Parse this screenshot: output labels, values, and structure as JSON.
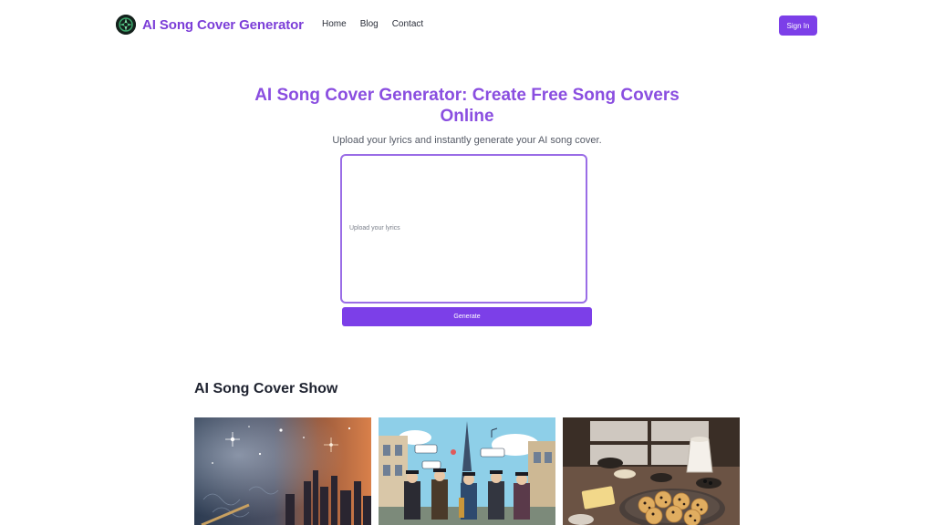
{
  "header": {
    "brand": "AI Song Cover Generator",
    "nav": [
      "Home",
      "Blog",
      "Contact"
    ],
    "sign_in": "Sign In"
  },
  "hero": {
    "title": "AI Song Cover Generator: Create Free Song Covers Online",
    "subtitle": "Upload your lyrics and instantly generate your AI song cover.",
    "lyrics_placeholder": "Upload your lyrics",
    "generate_label": "Generate"
  },
  "show": {
    "title": "AI Song Cover Show",
    "cards": [
      "space-city-cover",
      "paris-street-band-cover",
      "baking-kitchen-cover"
    ]
  },
  "colors": {
    "accent": "#7c3fe8",
    "title": "#8a4ee0"
  }
}
